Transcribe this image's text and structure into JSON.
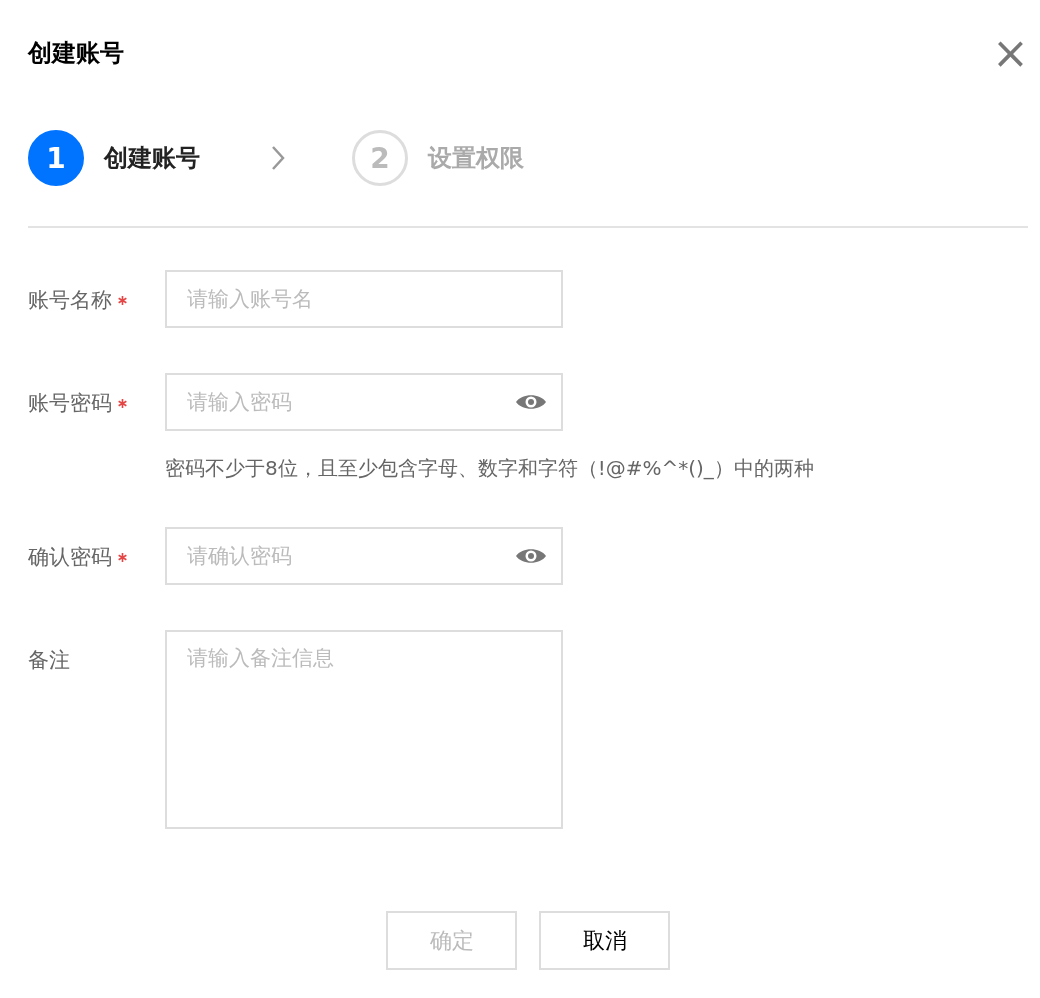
{
  "dialog": {
    "title": "创建账号",
    "close": "×"
  },
  "steps": [
    {
      "number": "1",
      "label": "创建账号",
      "selected": true
    },
    {
      "number": "2",
      "label": "设置权限",
      "selected": false
    }
  ],
  "fields": [
    {
      "kind": "text",
      "label": "账号名称",
      "required": true,
      "placeholder": "请输入账号名"
    },
    {
      "kind": "password",
      "label": "账号密码",
      "required": true,
      "placeholder": "请输入密码",
      "hint": "密码不少于8位，且至少包含字母、数字和字符（!@#%^*()_）中的两种"
    },
    {
      "kind": "password",
      "label": "确认密码",
      "required": true,
      "placeholder": "请确认密码"
    },
    {
      "kind": "textarea",
      "label": "备注",
      "required": false,
      "placeholder": "请输入备注信息"
    }
  ],
  "buttons": [
    {
      "label": "确定",
      "disabled": true
    },
    {
      "label": "取消",
      "disabled": false
    }
  ]
}
